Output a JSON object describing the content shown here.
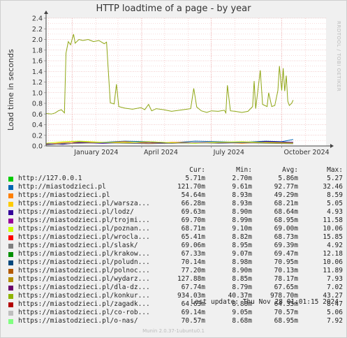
{
  "chart_data": {
    "type": "line",
    "title": "HTTP loadtime of a page - by year",
    "ylabel": "Load time in seconds",
    "xlabel": "",
    "ylim": [
      0,
      2.4
    ],
    "yticks": [
      "0.0",
      "0.2",
      "0.4",
      "0.6",
      "0.8",
      "1.0",
      "1.2",
      "1.4",
      "1.6",
      "1.8",
      "2.0",
      "2.2",
      "2.4"
    ],
    "xticks": [
      "January 2024",
      "April 2024",
      "July 2024",
      "October 2024"
    ],
    "x_range": [
      "2023-11-28",
      "2024-11-28"
    ],
    "xtick_dates": [
      "2024-01-01",
      "2024-04-01",
      "2024-07-01",
      "2024-10-01"
    ],
    "grid": true,
    "major_series": {
      "name": "https://miastodzieci.pl/konkur...",
      "color": "#8fa614",
      "points": [
        [
          "2023-11-28",
          0.61
        ],
        [
          "2023-12-05",
          0.6
        ],
        [
          "2023-12-10",
          0.62
        ],
        [
          "2023-12-14",
          0.66
        ],
        [
          "2023-12-18",
          0.68
        ],
        [
          "2023-12-22",
          0.62
        ],
        [
          "2023-12-24",
          1.74
        ],
        [
          "2023-12-27",
          1.96
        ],
        [
          "2023-12-30",
          1.9
        ],
        [
          "2024-01-03",
          2.1
        ],
        [
          "2024-01-05",
          1.93
        ],
        [
          "2024-01-10",
          2.0
        ],
        [
          "2024-01-15",
          1.98
        ],
        [
          "2024-01-22",
          2.0
        ],
        [
          "2024-01-29",
          1.96
        ],
        [
          "2024-02-05",
          1.98
        ],
        [
          "2024-02-12",
          1.92
        ],
        [
          "2024-02-15",
          1.95
        ],
        [
          "2024-02-20",
          0.81
        ],
        [
          "2024-02-25",
          0.79
        ],
        [
          "2024-02-28",
          1.16
        ],
        [
          "2024-03-02",
          0.74
        ],
        [
          "2024-03-10",
          0.71
        ],
        [
          "2024-03-20",
          0.69
        ],
        [
          "2024-03-31",
          0.72
        ],
        [
          "2024-04-05",
          0.68
        ],
        [
          "2024-04-10",
          0.78
        ],
        [
          "2024-04-14",
          0.66
        ],
        [
          "2024-04-20",
          0.7
        ],
        [
          "2024-04-30",
          0.68
        ],
        [
          "2024-05-10",
          0.65
        ],
        [
          "2024-05-20",
          0.67
        ],
        [
          "2024-05-30",
          0.69
        ],
        [
          "2024-06-04",
          0.7
        ],
        [
          "2024-06-08",
          1.08
        ],
        [
          "2024-06-12",
          0.73
        ],
        [
          "2024-06-18",
          0.66
        ],
        [
          "2024-06-25",
          0.63
        ],
        [
          "2024-07-01",
          0.66
        ],
        [
          "2024-07-10",
          0.65
        ],
        [
          "2024-07-18",
          0.67
        ],
        [
          "2024-07-20",
          0.62
        ],
        [
          "2024-07-22",
          1.14
        ],
        [
          "2024-07-26",
          0.66
        ],
        [
          "2024-08-01",
          0.65
        ],
        [
          "2024-08-10",
          0.63
        ],
        [
          "2024-08-18",
          0.65
        ],
        [
          "2024-08-24",
          0.74
        ],
        [
          "2024-08-26",
          1.22
        ],
        [
          "2024-08-28",
          0.7
        ],
        [
          "2024-09-03",
          1.42
        ],
        [
          "2024-09-06",
          0.78
        ],
        [
          "2024-09-12",
          0.74
        ],
        [
          "2024-09-14",
          1.0
        ],
        [
          "2024-09-18",
          0.74
        ],
        [
          "2024-09-22",
          0.76
        ],
        [
          "2024-09-26",
          1.04
        ],
        [
          "2024-09-28",
          1.5
        ],
        [
          "2024-10-01",
          1.04
        ],
        [
          "2024-10-03",
          1.46
        ],
        [
          "2024-10-05",
          1.03
        ],
        [
          "2024-10-07",
          1.32
        ],
        [
          "2024-10-09",
          0.84
        ],
        [
          "2024-10-11",
          0.76
        ],
        [
          "2024-10-14",
          0.8
        ],
        [
          "2024-10-16",
          0.86
        ]
      ]
    },
    "minor_traces": [
      {
        "color": "#0066b3",
        "points": [
          [
            "2023-11-28",
            0.02
          ],
          [
            "2023-12-20",
            0.05
          ],
          [
            "2024-01-10",
            0.08
          ],
          [
            "2024-02-10",
            0.07
          ],
          [
            "2024-03-10",
            0.09
          ],
          [
            "2024-04-10",
            0.08
          ],
          [
            "2024-05-10",
            0.06
          ],
          [
            "2024-06-10",
            0.09
          ],
          [
            "2024-07-10",
            0.08
          ],
          [
            "2024-08-10",
            0.07
          ],
          [
            "2024-09-10",
            0.09
          ],
          [
            "2024-10-01",
            0.08
          ],
          [
            "2024-10-16",
            0.12
          ]
        ]
      },
      {
        "color": "#ff8000",
        "points": [
          [
            "2023-11-28",
            0.03
          ],
          [
            "2023-12-20",
            0.06
          ],
          [
            "2024-01-10",
            0.07
          ],
          [
            "2024-02-10",
            0.06
          ],
          [
            "2024-03-10",
            0.08
          ],
          [
            "2024-04-10",
            0.05
          ],
          [
            "2024-05-10",
            0.07
          ],
          [
            "2024-06-10",
            0.06
          ],
          [
            "2024-07-10",
            0.07
          ],
          [
            "2024-08-10",
            0.05
          ],
          [
            "2024-09-10",
            0.07
          ],
          [
            "2024-10-16",
            0.06
          ]
        ]
      },
      {
        "color": "#330099",
        "points": [
          [
            "2023-11-28",
            0.04
          ],
          [
            "2023-12-20",
            0.03
          ],
          [
            "2024-01-10",
            0.06
          ],
          [
            "2024-02-10",
            0.05
          ],
          [
            "2024-03-10",
            0.06
          ],
          [
            "2024-04-10",
            0.07
          ],
          [
            "2024-05-10",
            0.05
          ],
          [
            "2024-06-10",
            0.06
          ],
          [
            "2024-07-10",
            0.06
          ],
          [
            "2024-08-10",
            0.06
          ],
          [
            "2024-09-10",
            0.08
          ],
          [
            "2024-10-16",
            0.07
          ]
        ]
      },
      {
        "color": "#ccff00",
        "points": [
          [
            "2023-11-28",
            0.05
          ],
          [
            "2023-12-20",
            0.08
          ],
          [
            "2024-01-10",
            0.09
          ],
          [
            "2024-02-10",
            0.07
          ],
          [
            "2024-03-10",
            0.06
          ],
          [
            "2024-04-10",
            0.08
          ],
          [
            "2024-05-10",
            0.06
          ],
          [
            "2024-06-10",
            0.05
          ],
          [
            "2024-07-10",
            0.07
          ],
          [
            "2024-08-10",
            0.08
          ],
          [
            "2024-09-10",
            0.06
          ],
          [
            "2024-10-16",
            0.05
          ]
        ]
      },
      {
        "color": "#808080",
        "points": [
          [
            "2023-11-28",
            0.02
          ],
          [
            "2023-12-20",
            0.04
          ],
          [
            "2024-01-10",
            0.05
          ],
          [
            "2024-02-10",
            0.06
          ],
          [
            "2024-03-10",
            0.05
          ],
          [
            "2024-04-10",
            0.04
          ],
          [
            "2024-05-10",
            0.05
          ],
          [
            "2024-06-10",
            0.06
          ],
          [
            "2024-07-10",
            0.05
          ],
          [
            "2024-08-10",
            0.06
          ],
          [
            "2024-09-10",
            0.05
          ],
          [
            "2024-10-16",
            0.04
          ]
        ]
      }
    ],
    "series": [
      {
        "name": "http://127.0.0.1",
        "color": "#00cc00",
        "cur": "5.71m",
        "min": "2.70m",
        "avg": "5.86m",
        "max": "5.27"
      },
      {
        "name": "http://miastodzieci.pl",
        "color": "#0066b3",
        "cur": "121.70m",
        "min": "9.61m",
        "avg": "92.77m",
        "max": "32.46"
      },
      {
        "name": "https://miastodzieci.pl",
        "color": "#ff8000",
        "cur": "54.64m",
        "min": "8.93m",
        "avg": "49.29m",
        "max": "8.59"
      },
      {
        "name": "https://miastodzieci.pl/warsza...",
        "color": "#ffcc00",
        "cur": "66.28m",
        "min": "8.93m",
        "avg": "68.21m",
        "max": "5.05"
      },
      {
        "name": "https://miastodzieci.pl/lodz/",
        "color": "#330099",
        "cur": "69.63m",
        "min": "8.90m",
        "avg": "68.64m",
        "max": "4.93"
      },
      {
        "name": "https://miastodzieci.pl/trojmi...",
        "color": "#990099",
        "cur": "69.70m",
        "min": "8.99m",
        "avg": "68.95m",
        "max": "11.58"
      },
      {
        "name": "https://miastodzieci.pl/poznan...",
        "color": "#ccff00",
        "cur": "68.71m",
        "min": "9.10m",
        "avg": "69.00m",
        "max": "10.06"
      },
      {
        "name": "https://miastodzieci.pl/wrocla...",
        "color": "#ff0000",
        "cur": "65.41m",
        "min": "8.82m",
        "avg": "68.73m",
        "max": "15.85"
      },
      {
        "name": "https://miastodzieci.pl/slask/",
        "color": "#808080",
        "cur": "69.06m",
        "min": "8.95m",
        "avg": "69.39m",
        "max": "4.92"
      },
      {
        "name": "https://miastodzieci.pl/krakow...",
        "color": "#008f00",
        "cur": "67.33m",
        "min": "9.07m",
        "avg": "69.47m",
        "max": "12.18"
      },
      {
        "name": "https://miastodzieci.pl/poludn...",
        "color": "#00487d",
        "cur": "70.14m",
        "min": "8.98m",
        "avg": "70.95m",
        "max": "10.06"
      },
      {
        "name": "https://miastodzieci.pl/polnoc...",
        "color": "#b35a00",
        "cur": "77.20m",
        "min": "8.90m",
        "avg": "70.13m",
        "max": "11.89"
      },
      {
        "name": "https://miastodzieci.pl/wydarz...",
        "color": "#b38f00",
        "cur": "127.88m",
        "min": "8.85m",
        "avg": "78.17m",
        "max": "7.93"
      },
      {
        "name": "https://miastodzieci.pl/dla-dz...",
        "color": "#6b006b",
        "cur": "67.74m",
        "min": "8.79m",
        "avg": "67.65m",
        "max": "7.02"
      },
      {
        "name": "https://miastodzieci.pl/konkur...",
        "color": "#8fb300",
        "cur": "934.03m",
        "min": "40.37m",
        "avg": "978.70m",
        "max": "43.27"
      },
      {
        "name": "https://miastodzieci.pl/zagadk...",
        "color": "#b30000",
        "cur": "64.63m",
        "min": "8.88m",
        "avg": "64.35m",
        "max": "8.47"
      },
      {
        "name": "https://miastodzieci.pl/co-rob...",
        "color": "#bebebe",
        "cur": "69.14m",
        "min": "9.05m",
        "avg": "70.57m",
        "max": "5.06"
      },
      {
        "name": "https://miastodzieci.pl/o-nas/",
        "color": "#80ff80",
        "cur": "70.57m",
        "min": "8.68m",
        "avg": "68.95m",
        "max": "7.92"
      }
    ]
  },
  "legend_header": {
    "cur": "Cur:",
    "min": "Min:",
    "avg": "Avg:",
    "max": "Max:"
  },
  "last_update": "Last update: Thu Nov 28 01:01:15 2024",
  "side_tag": "RRDTOOL / TOBI OETIKER",
  "footer": "Munin 2.0.37-1ubuntu0.1"
}
